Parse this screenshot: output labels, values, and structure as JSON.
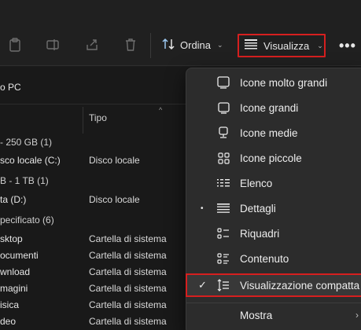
{
  "toolbar": {
    "sort_label": "Ordina",
    "view_label": "Visualizza",
    "more_label": "•••"
  },
  "location": "o PC",
  "columns": {
    "type_header": "Tipo"
  },
  "groups": [
    "- 250 GB (1)",
    "B - 1 TB (1)",
    "pecificato (6)"
  ],
  "rows": [
    {
      "name": "sco locale (C:)",
      "type": "Disco locale"
    },
    {
      "name": "ta (D:)",
      "type": "Disco locale"
    },
    {
      "name": "sktop",
      "type": "Cartella di sistema"
    },
    {
      "name": "ocumenti",
      "type": "Cartella di sistema"
    },
    {
      "name": "wnload",
      "type": "Cartella di sistema"
    },
    {
      "name": "magini",
      "type": "Cartella di sistema"
    },
    {
      "name": "isica",
      "type": "Cartella di sistema"
    },
    {
      "name": "deo",
      "type": "Cartella di sistema"
    }
  ],
  "menu": {
    "items": [
      {
        "label": "Icone molto grandi",
        "icon": "monitor-icon"
      },
      {
        "label": "Icone grandi",
        "icon": "monitor-icon"
      },
      {
        "label": "Icone medie",
        "icon": "monitor-stand-icon"
      },
      {
        "label": "Icone piccole",
        "icon": "grid-icon"
      },
      {
        "label": "Elenco",
        "icon": "list-icon"
      },
      {
        "label": "Dettagli",
        "icon": "details-icon",
        "bullet": "•"
      },
      {
        "label": "Riquadri",
        "icon": "tiles-icon"
      },
      {
        "label": "Contenuto",
        "icon": "content-icon"
      },
      {
        "label": "Visualizzazione compatta",
        "icon": "compact-icon",
        "check": "✓"
      },
      {
        "label": "Mostra",
        "submenu": "›"
      }
    ]
  },
  "colors": {
    "highlight": "#d61f1f",
    "menu_bg": "#2c2c2c",
    "toolbar_bg": "#202020"
  }
}
